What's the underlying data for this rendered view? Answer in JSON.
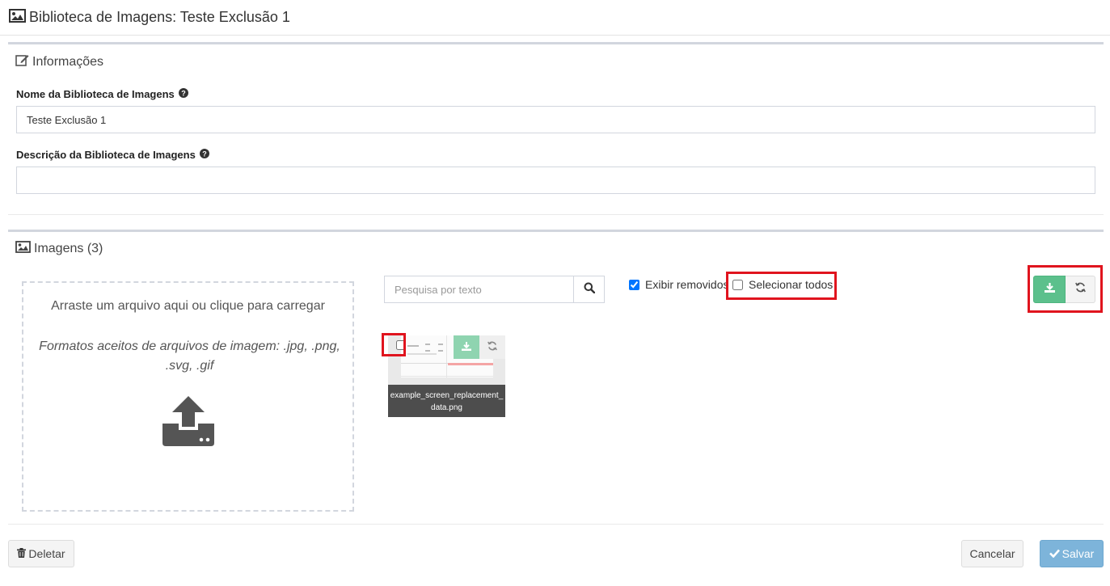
{
  "header": {
    "title": "Biblioteca de Imagens: Teste Exclusão 1",
    "icon": "image-icon"
  },
  "info": {
    "title": "Informações",
    "icon": "edit-icon",
    "name_label": "Nome da Biblioteca de Imagens",
    "name_value": "Teste Exclusão 1",
    "description_label": "Descrição da Biblioteca de Imagens",
    "description_value": ""
  },
  "images": {
    "title": "Imagens (3)",
    "icon": "image-icon",
    "dropzone": {
      "main_text": "Arraste um arquivo aqui ou clique para carregar",
      "formats_text": "Formatos aceitos de arquivos de imagem: .jpg, .png, .svg, .gif",
      "icon": "upload-icon"
    },
    "search_placeholder": "Pesquisa por texto",
    "show_removed_label": "Exibir removidos",
    "show_removed_checked": true,
    "select_all_label": "Selecionar todos",
    "select_all_checked": false,
    "items": [
      {
        "filename": "example_screen_replacement_data.png",
        "checked": false
      }
    ]
  },
  "footer": {
    "delete_label": "Deletar",
    "cancel_label": "Cancelar",
    "save_label": "Salvar"
  },
  "colors": {
    "accent_green": "#5cc08c",
    "save_blue": "#7db4da",
    "highlight_red": "#e0141e"
  }
}
